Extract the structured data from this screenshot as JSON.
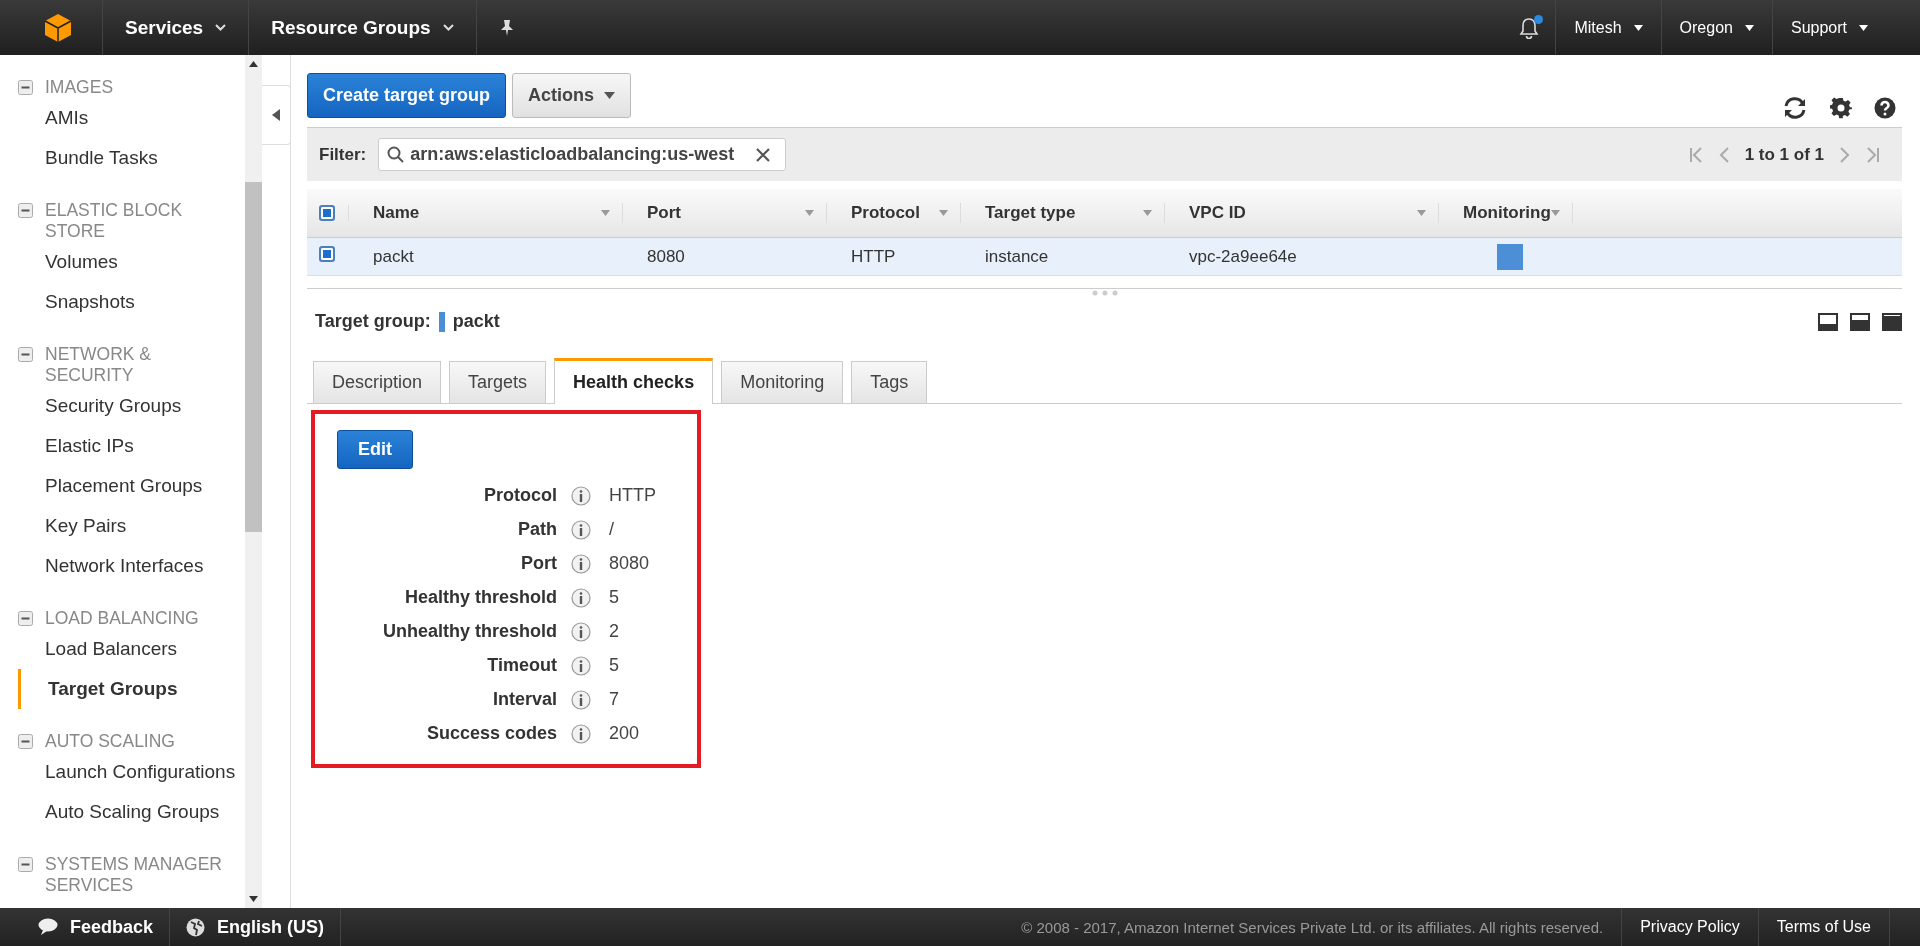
{
  "top_nav": {
    "menus": [
      {
        "label": "Services"
      },
      {
        "label": "Resource Groups"
      }
    ],
    "notifications": {
      "unread": true
    },
    "right_menus": [
      {
        "label": "Mitesh"
      },
      {
        "label": "Oregon"
      },
      {
        "label": "Support"
      }
    ]
  },
  "sidebar": {
    "sections": [
      {
        "title": "IMAGES",
        "expanded": true,
        "items": [
          {
            "label": "AMIs",
            "selected": false
          },
          {
            "label": "Bundle Tasks",
            "selected": false
          }
        ]
      },
      {
        "title": "ELASTIC BLOCK STORE",
        "expanded": true,
        "items": [
          {
            "label": "Volumes",
            "selected": false
          },
          {
            "label": "Snapshots",
            "selected": false
          }
        ]
      },
      {
        "title": "NETWORK & SECURITY",
        "expanded": true,
        "items": [
          {
            "label": "Security Groups",
            "selected": false
          },
          {
            "label": "Elastic IPs",
            "selected": false
          },
          {
            "label": "Placement Groups",
            "selected": false
          },
          {
            "label": "Key Pairs",
            "selected": false
          },
          {
            "label": "Network Interfaces",
            "selected": false
          }
        ]
      },
      {
        "title": "LOAD BALANCING",
        "expanded": true,
        "items": [
          {
            "label": "Load Balancers",
            "selected": false
          },
          {
            "label": "Target Groups",
            "selected": true
          }
        ]
      },
      {
        "title": "AUTO SCALING",
        "expanded": true,
        "items": [
          {
            "label": "Launch Configurations",
            "selected": false
          },
          {
            "label": "Auto Scaling Groups",
            "selected": false
          }
        ]
      },
      {
        "title": "SYSTEMS MANAGER SERVICES",
        "expanded": true
      }
    ]
  },
  "toolbar": {
    "create_button": "Create target group",
    "actions_button": "Actions"
  },
  "filter": {
    "label": "Filter:",
    "value": "arn:aws:elasticloadbalancing:us-west",
    "pagination": "1 to 1 of 1"
  },
  "table": {
    "all_checked": true,
    "columns": [
      "Name",
      "Port",
      "Protocol",
      "Target type",
      "VPC ID",
      "Monitoring"
    ],
    "rows": [
      {
        "selected": true,
        "cells": [
          "packt",
          "8080",
          "HTTP",
          "instance",
          "vpc-2a9ee64e"
        ]
      }
    ]
  },
  "detail": {
    "title_label": "Target group:",
    "title_value": "packt",
    "tabs": [
      {
        "label": "Description",
        "selected": false
      },
      {
        "label": "Targets",
        "selected": false
      },
      {
        "label": "Health checks",
        "selected": true
      },
      {
        "label": "Monitoring",
        "selected": false
      },
      {
        "label": "Tags",
        "selected": false
      }
    ],
    "edit_button": "Edit",
    "fields": [
      {
        "label": "Protocol",
        "value": "HTTP"
      },
      {
        "label": "Path",
        "value": "/"
      },
      {
        "label": "Port",
        "value": "8080"
      },
      {
        "label": "Healthy threshold",
        "value": "5"
      },
      {
        "label": "Unhealthy threshold",
        "value": "2"
      },
      {
        "label": "Timeout",
        "value": "5"
      },
      {
        "label": "Interval",
        "value": "7"
      },
      {
        "label": "Success codes",
        "value": "200"
      }
    ]
  },
  "footer": {
    "feedback": "Feedback",
    "language": "English (US)",
    "copyright": "© 2008 - 2017, Amazon Internet Services Private Ltd. or its affiliates. All rights reserved.",
    "links": [
      "Privacy Policy",
      "Terms of Use"
    ]
  }
}
